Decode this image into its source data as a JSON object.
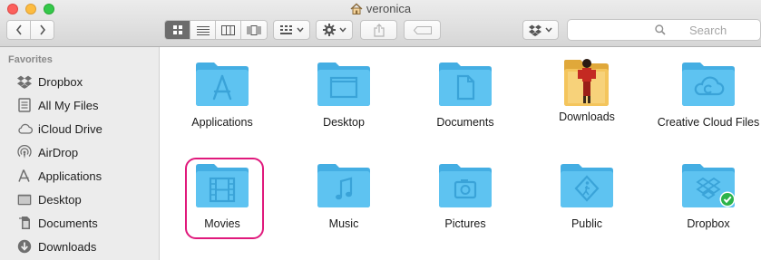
{
  "window": {
    "title": "veronica"
  },
  "toolbar": {
    "back_icon": "chevron-left-icon",
    "forward_icon": "chevron-right-icon",
    "view_modes": [
      "icon-view-icon",
      "list-view-icon",
      "column-view-icon",
      "cover-flow-icon"
    ],
    "active_view": "icon-view-icon",
    "search": {
      "placeholder": "Search",
      "value": ""
    }
  },
  "sidebar": {
    "header": "Favorites",
    "items": [
      {
        "label": "Dropbox",
        "icon": "dropbox-icon"
      },
      {
        "label": "All My Files",
        "icon": "all-files-icon"
      },
      {
        "label": "iCloud Drive",
        "icon": "cloud-icon"
      },
      {
        "label": "AirDrop",
        "icon": "airdrop-icon"
      },
      {
        "label": "Applications",
        "icon": "applications-icon"
      },
      {
        "label": "Desktop",
        "icon": "desktop-icon"
      },
      {
        "label": "Documents",
        "icon": "documents-icon"
      },
      {
        "label": "Downloads",
        "icon": "downloads-icon"
      }
    ]
  },
  "content": {
    "items": [
      {
        "label": "Applications",
        "icon": "applications-folder-icon"
      },
      {
        "label": "Desktop",
        "icon": "desktop-folder-icon"
      },
      {
        "label": "Documents",
        "icon": "documents-folder-icon"
      },
      {
        "label": "Downloads",
        "icon": "downloads-folder-icon"
      },
      {
        "label": "Creative Cloud Files",
        "icon": "creative-cloud-folder-icon"
      },
      {
        "label": "Movies",
        "icon": "movies-folder-icon",
        "highlighted": true
      },
      {
        "label": "Music",
        "icon": "music-folder-icon"
      },
      {
        "label": "Pictures",
        "icon": "pictures-folder-icon"
      },
      {
        "label": "Public",
        "icon": "public-folder-icon"
      },
      {
        "label": "Dropbox",
        "icon": "dropbox-folder-icon",
        "badge": "synced-check-icon"
      }
    ]
  },
  "colors": {
    "folder": "#5ec3f1",
    "folder_dark": "#44aee3",
    "highlight_ring": "#e0197c",
    "sync_badge": "#2cb34a"
  }
}
